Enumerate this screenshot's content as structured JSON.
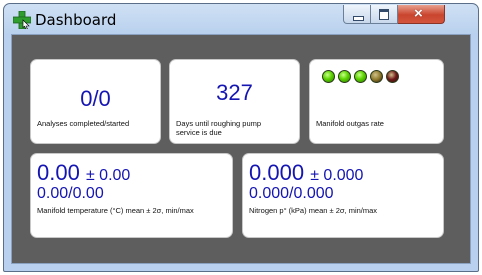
{
  "window": {
    "title": "Dashboard",
    "buttons": {
      "minimize": "",
      "maximize": "",
      "close": "×"
    }
  },
  "tiles": {
    "analyses": {
      "value": "0/0",
      "label": "Analyses completed/started"
    },
    "pump": {
      "value": "327",
      "label": "Days until roughing pump service is due"
    },
    "outgas": {
      "label": "Manifold outgas rate",
      "leds": [
        {
          "state": "on",
          "color": "#5cd400"
        },
        {
          "state": "on",
          "color": "#5cd400"
        },
        {
          "state": "on",
          "color": "#5cd400"
        },
        {
          "state": "dim",
          "color": "#8f7a2c"
        },
        {
          "state": "dim",
          "color": "#6e1616"
        }
      ]
    },
    "temperature": {
      "mean": "0.00",
      "pm": "± 0.00",
      "minmax": "0.00/0.00",
      "label": "Manifold temperature (°C) mean ± 2σ, min/max"
    },
    "nitrogen": {
      "mean": "0.000",
      "pm": "± 0.000",
      "minmax": "0.000/0.000",
      "label": "Nitrogen p° (kPa) mean ± 2σ, min/max"
    }
  },
  "icons": {
    "app": "green-plus-icon"
  },
  "colors": {
    "value_blue": "#1515b3",
    "background": "#5e5e5e"
  }
}
